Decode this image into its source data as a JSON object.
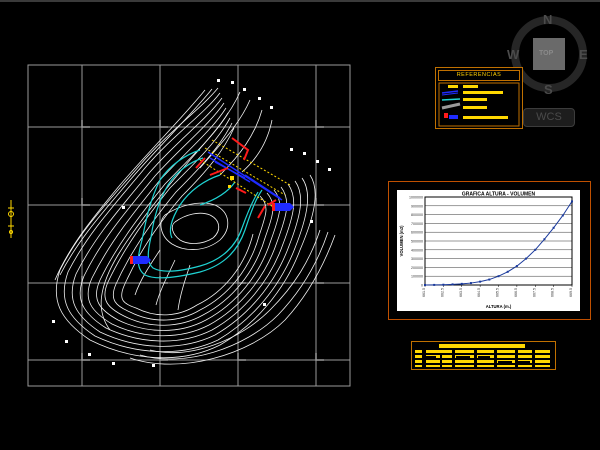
{
  "viewcube": {
    "north": "N",
    "south": "S",
    "east": "E",
    "west": "W",
    "face_label": "TOP"
  },
  "wcs_label": "WCS",
  "referencias": {
    "title": "REFERENCIAS"
  },
  "chart_data": {
    "type": "line",
    "title": "GRAFICA ALTURA - VOLUMEN",
    "xlabel": "ALTURA (m.)",
    "ylabel": "VOLUMEN (m3)",
    "ylim": [
      0,
      1000000
    ],
    "yticks": [
      "1000000",
      "900000",
      "800000",
      "700000",
      "600000",
      "500000",
      "400000",
      "300000",
      "200000",
      "100000",
      "0"
    ],
    "xticks": [
      "661.5",
      "662.5",
      "663.5",
      "664.5",
      "665.5",
      "666.5",
      "667.5",
      "668.5",
      "669.5"
    ],
    "series": [
      {
        "color": "#1a3a9c",
        "x": [
          661.5,
          662.0,
          662.5,
          663.0,
          663.5,
          664.0,
          664.5,
          665.0,
          665.5,
          666.0,
          666.5,
          667.0,
          667.5,
          668.0,
          668.5,
          669.0,
          669.5
        ],
        "values": [
          0,
          1000,
          3000,
          7000,
          13000,
          22000,
          38000,
          62000,
          100000,
          150000,
          215000,
          300000,
          400000,
          520000,
          650000,
          790000,
          950000
        ]
      }
    ]
  },
  "colors": {
    "contour": "#ffffff",
    "water": "#1fd3d3",
    "dam_red": "#ff1a1a",
    "dam_blue": "#1f2bff",
    "dam_yellow": "#ffd800",
    "frame_orange": "#c06000",
    "grid": "#9a9a9a"
  }
}
